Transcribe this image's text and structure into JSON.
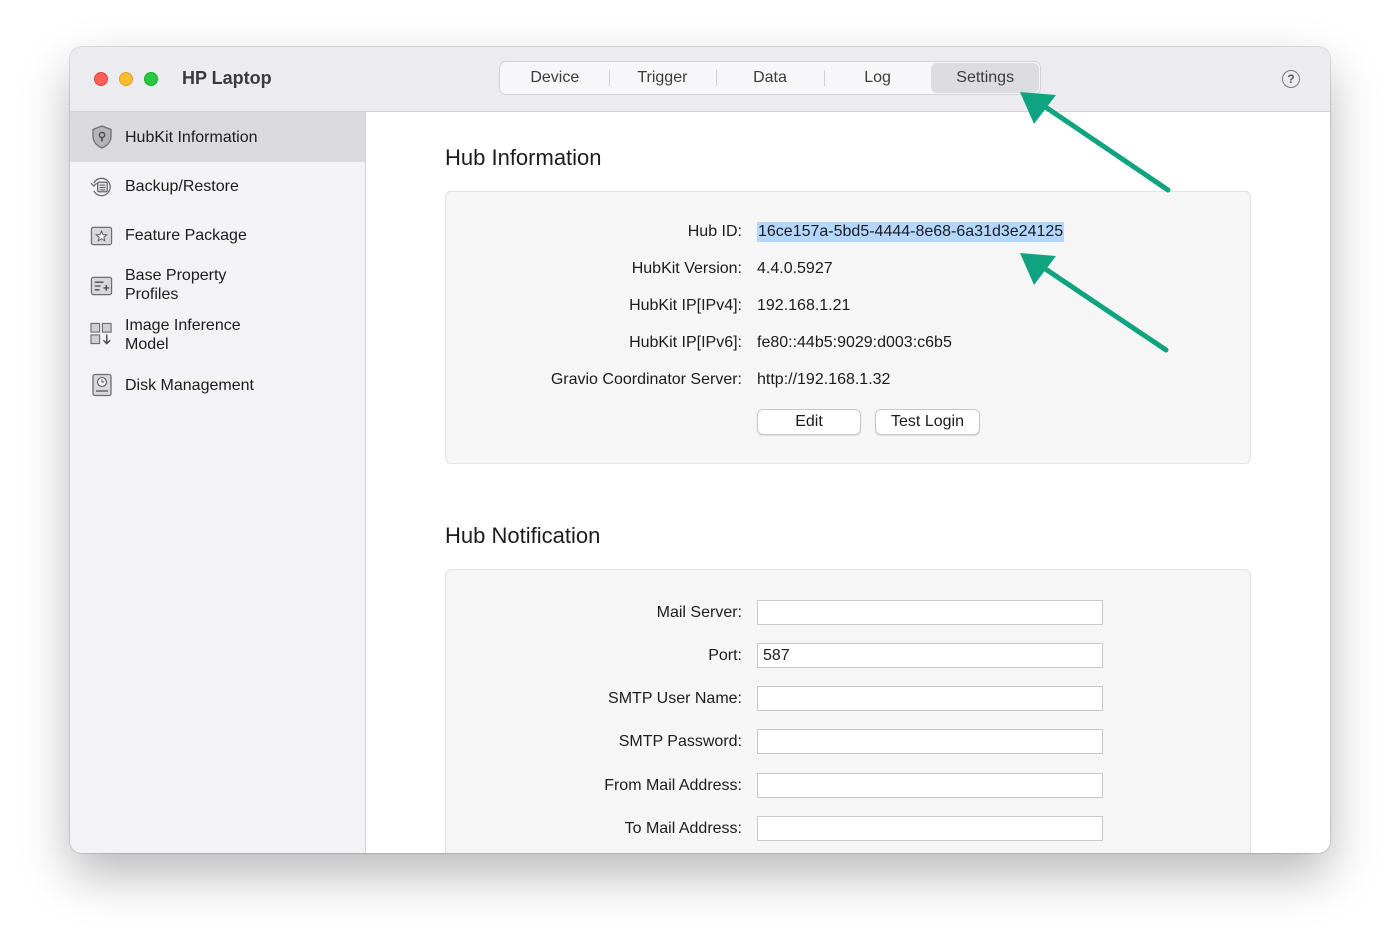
{
  "window": {
    "title": "HP Laptop"
  },
  "tabs": [
    {
      "label": "Device",
      "active": false
    },
    {
      "label": "Trigger",
      "active": false
    },
    {
      "label": "Data",
      "active": false
    },
    {
      "label": "Log",
      "active": false
    },
    {
      "label": "Settings",
      "active": true
    }
  ],
  "help_icon": "question-circle-icon",
  "help_glyph": "?",
  "sidebar": {
    "items": [
      {
        "label_line1": "HubKit Information",
        "label_line2": "",
        "icon": "shield-icon",
        "selected": true
      },
      {
        "label_line1": "Backup/Restore",
        "label_line2": "",
        "icon": "backup-restore-icon",
        "selected": false
      },
      {
        "label_line1": "Feature Package",
        "label_line2": "",
        "icon": "star-package-icon",
        "selected": false
      },
      {
        "label_line1": "Base Property",
        "label_line2": "Profiles",
        "icon": "property-profile-icon",
        "selected": false
      },
      {
        "label_line1": "Image Inference",
        "label_line2": "Model",
        "icon": "grid-download-icon",
        "selected": false
      },
      {
        "label_line1": "Disk Management",
        "label_line2": "",
        "icon": "disk-icon",
        "selected": false
      }
    ]
  },
  "hub_information": {
    "title": "Hub Information",
    "rows": [
      {
        "label": "Hub ID:",
        "value": "16ce157a-5bd5-4444-8e68-6a31d3e24125"
      },
      {
        "label": "HubKit Version:",
        "value": "4.4.0.5927"
      },
      {
        "label": "HubKit IP[IPv4]:",
        "value": "192.168.1.21"
      },
      {
        "label": "HubKit IP[IPv6]:",
        "value": "fe80::44b5:9029:d003:c6b5"
      },
      {
        "label": "Gravio Coordinator Server:",
        "value": "http://192.168.1.32"
      }
    ],
    "edit_label": "Edit",
    "test_login_label": "Test Login"
  },
  "hub_notification": {
    "title": "Hub Notification",
    "fields": [
      {
        "label": "Mail Server:",
        "value": ""
      },
      {
        "label": "Port:",
        "value": "587"
      },
      {
        "label": "SMTP User Name:",
        "value": ""
      },
      {
        "label": "SMTP Password:",
        "value": ""
      },
      {
        "label": "From Mail Address:",
        "value": ""
      },
      {
        "label": "To Mail Address:",
        "value": ""
      }
    ]
  },
  "colors": {
    "annotation_arrow": "#10a37f",
    "selection_highlight": "#b3d7ff",
    "close": "#fe5f57",
    "minimize": "#febc2e",
    "maximize": "#28c840"
  }
}
